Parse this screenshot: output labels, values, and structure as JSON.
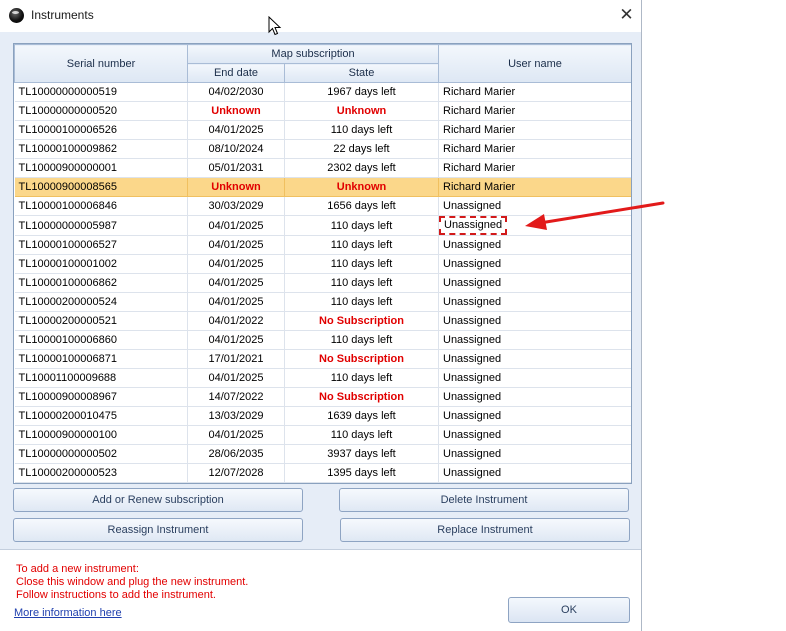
{
  "window": {
    "title": "Instruments",
    "close_glyph": "✕"
  },
  "grid": {
    "headers": {
      "serial": "Serial number",
      "map_subscription": "Map subscription",
      "end_date": "End date",
      "state": "State",
      "user": "User name"
    },
    "rows": [
      {
        "serial": "TL10000000000519",
        "end_date": "04/02/2030",
        "state": "1967 days left",
        "user": "Richard Marier"
      },
      {
        "serial": "TL10000000000520",
        "end_date": "Unknown",
        "state": "Unknown",
        "user": "Richard Marier",
        "end_red": true,
        "state_red": true
      },
      {
        "serial": "TL10000100006526",
        "end_date": "04/01/2025",
        "state": "110 days left",
        "user": "Richard Marier"
      },
      {
        "serial": "TL10000100009862",
        "end_date": "08/10/2024",
        "state": "22 days left",
        "user": "Richard Marier"
      },
      {
        "serial": "TL10000900000001",
        "end_date": "05/01/2031",
        "state": "2302 days left",
        "user": "Richard Marier"
      },
      {
        "serial": "TL10000900008565",
        "end_date": "Unknown",
        "state": "Unknown",
        "user": "Richard Marier",
        "end_red": true,
        "state_red": true,
        "selected": true
      },
      {
        "serial": "TL10000100006846",
        "end_date": "30/03/2029",
        "state": "1656 days left",
        "user": "Unassigned"
      },
      {
        "serial": "TL10000000005987",
        "end_date": "04/01/2025",
        "state": "110 days left",
        "user": "Unassigned",
        "highlight": true
      },
      {
        "serial": "TL10000100006527",
        "end_date": "04/01/2025",
        "state": "110 days left",
        "user": "Unassigned"
      },
      {
        "serial": "TL10000100001002",
        "end_date": "04/01/2025",
        "state": "110 days left",
        "user": "Unassigned"
      },
      {
        "serial": "TL10000100006862",
        "end_date": "04/01/2025",
        "state": "110 days left",
        "user": "Unassigned"
      },
      {
        "serial": "TL10000200000524",
        "end_date": "04/01/2025",
        "state": "110 days left",
        "user": "Unassigned"
      },
      {
        "serial": "TL10000200000521",
        "end_date": "04/01/2022",
        "state": "No Subscription",
        "user": "Unassigned",
        "state_red": true
      },
      {
        "serial": "TL10000100006860",
        "end_date": "04/01/2025",
        "state": "110 days left",
        "user": "Unassigned"
      },
      {
        "serial": "TL10000100006871",
        "end_date": "17/01/2021",
        "state": "No Subscription",
        "user": "Unassigned",
        "state_red": true
      },
      {
        "serial": "TL10001100009688",
        "end_date": "04/01/2025",
        "state": "110 days left",
        "user": "Unassigned"
      },
      {
        "serial": "TL10000900008967",
        "end_date": "14/07/2022",
        "state": "No Subscription",
        "user": "Unassigned",
        "state_red": true
      },
      {
        "serial": "TL10000200010475",
        "end_date": "13/03/2029",
        "state": "1639 days left",
        "user": "Unassigned"
      },
      {
        "serial": "TL10000900000100",
        "end_date": "04/01/2025",
        "state": "110 days left",
        "user": "Unassigned"
      },
      {
        "serial": "TL10000000000502",
        "end_date": "28/06/2035",
        "state": "3937 days left",
        "user": "Unassigned"
      },
      {
        "serial": "TL10000200000523",
        "end_date": "12/07/2028",
        "state": "1395 days left",
        "user": "Unassigned"
      }
    ]
  },
  "buttons": {
    "add_renew": "Add or Renew subscription",
    "delete": "Delete Instrument",
    "reassign": "Reassign Instrument",
    "replace": "Replace Instrument",
    "ok": "OK"
  },
  "info": {
    "line1": "To add a new instrument:",
    "line2": "Close this window and plug the new instrument.",
    "line3": "Follow instructions to add the instrument.",
    "link": "More information here"
  },
  "colors": {
    "error_red": "#e10000",
    "selected_row": "#fbd78a",
    "annotation_red": "#d21a1a",
    "dialog_bg": "#e6edf7"
  },
  "icons": {
    "app": "instrument-app-icon",
    "close": "close-icon",
    "cursor": "mouse-pointer-icon",
    "annotation": "red-arrow-annotation"
  }
}
